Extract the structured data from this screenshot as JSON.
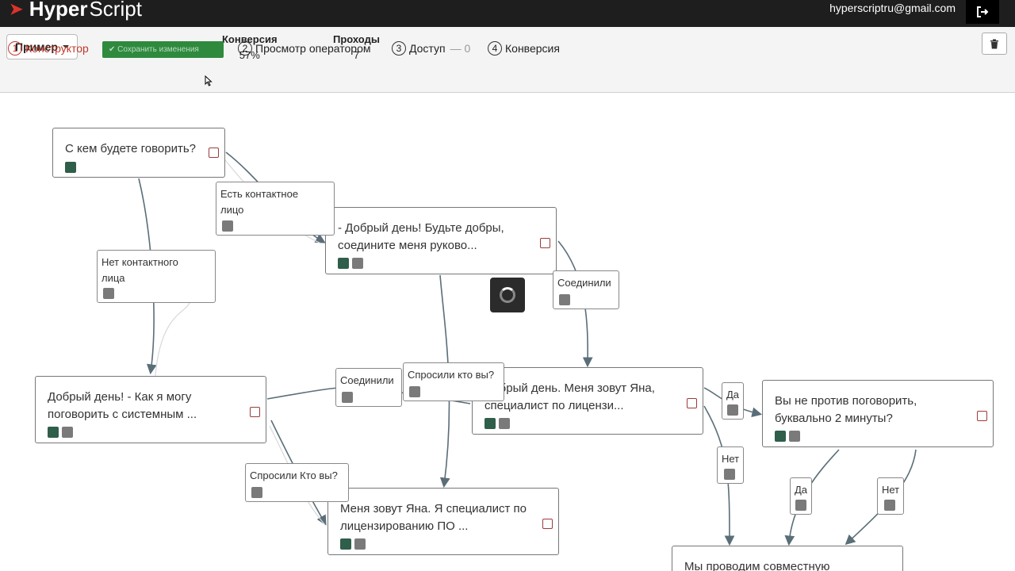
{
  "header": {
    "brand_prefix": "Hyper",
    "brand_suffix": "Script",
    "email": "hyperscriptru@gmail.com"
  },
  "toolbar": {
    "example_label": "Пример",
    "conversion_label": "Конверсия",
    "conversion_value": "57%",
    "passes_label": "Проходы",
    "passes_value": "7",
    "save_label": "✔ Сохранить изменения"
  },
  "steps": [
    {
      "num": "1",
      "label": "Конструктор"
    },
    {
      "num": "2",
      "label": "Просмотр оператором"
    },
    {
      "num": "3",
      "label": "Доступ",
      "extra": "— 0"
    },
    {
      "num": "4",
      "label": "Конверсия"
    }
  ],
  "nodes": [
    {
      "text": "С кем будете говорить?"
    },
    {
      "text": "- Добрый день! Будьте добры, соедините меня руково..."
    },
    {
      "text": "Добрый день! - Как я могу поговорить с системным ..."
    },
    {
      "text": "Добрый день. Меня зовут Яна, специалист по лицензи..."
    },
    {
      "text": "Вы не против поговорить, буквально 2 минуты?"
    },
    {
      "text": "Меня зовут Яна. Я специалист по лицензированию ПО ..."
    },
    {
      "text": "Мы проводим совместную"
    }
  ],
  "edges": [
    {
      "text": "Есть контактное лицо"
    },
    {
      "text": "Нет контактного лица"
    },
    {
      "text": "Соединили"
    },
    {
      "text": "Соединили"
    },
    {
      "text": "Спросили кто вы?"
    },
    {
      "text": "Спросили Кто вы?"
    },
    {
      "text": "Да"
    },
    {
      "text": "Нет"
    },
    {
      "text": "Да"
    },
    {
      "text": "Нет"
    }
  ],
  "colors": {
    "topbar": "#1e1e1e",
    "save_button": "#2f8a3e",
    "active_step": "#c0392b",
    "connector": "#5a6e78"
  }
}
